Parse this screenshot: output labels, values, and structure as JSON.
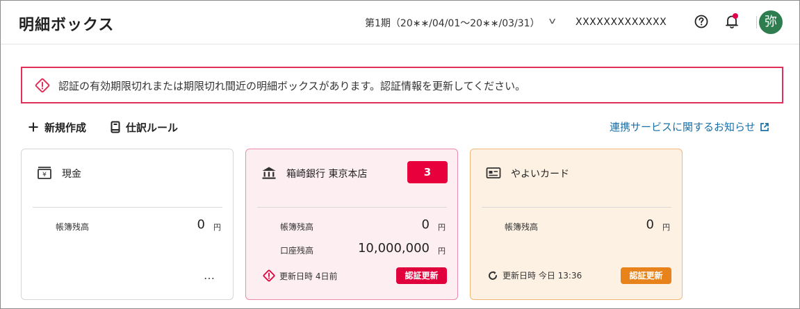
{
  "header": {
    "title": "明細ボックス",
    "period": "第1期（20∗∗/04/01〜20∗∗/03/31）",
    "company": "XXXXXXXXXXXXX",
    "avatar_char": "弥"
  },
  "alert": {
    "message": "認証の有効期限切れまたは期限切れ間近の明細ボックスがあります。認証情報を更新してください。"
  },
  "toolbar": {
    "new_label": "新規作成",
    "rules_label": "仕訳ルール",
    "news_label": "連携サービスに関するお知らせ"
  },
  "cards": [
    {
      "name": "現金",
      "rows": [
        {
          "label": "帳簿残高",
          "value": "0",
          "unit": "円"
        }
      ],
      "more": "…"
    },
    {
      "name": "箱崎銀行 東京本店",
      "badge": "3",
      "rows": [
        {
          "label": "帳簿残高",
          "value": "0",
          "unit": "円"
        },
        {
          "label": "口座残高",
          "value": "10,000,000",
          "unit": "円"
        }
      ],
      "updated": "更新日時 4日前",
      "renew": "認証更新"
    },
    {
      "name": "やよいカード",
      "rows": [
        {
          "label": "帳簿残高",
          "value": "0",
          "unit": "円"
        }
      ],
      "updated": "更新日時 今日 13:36",
      "renew": "認証更新"
    }
  ],
  "colors": {
    "alert_border": "#e0305a",
    "badge_red": "#e8003d",
    "renew_orange": "#e8821b",
    "link_blue": "#1a6fa8",
    "avatar_green": "#2e7d4f"
  }
}
